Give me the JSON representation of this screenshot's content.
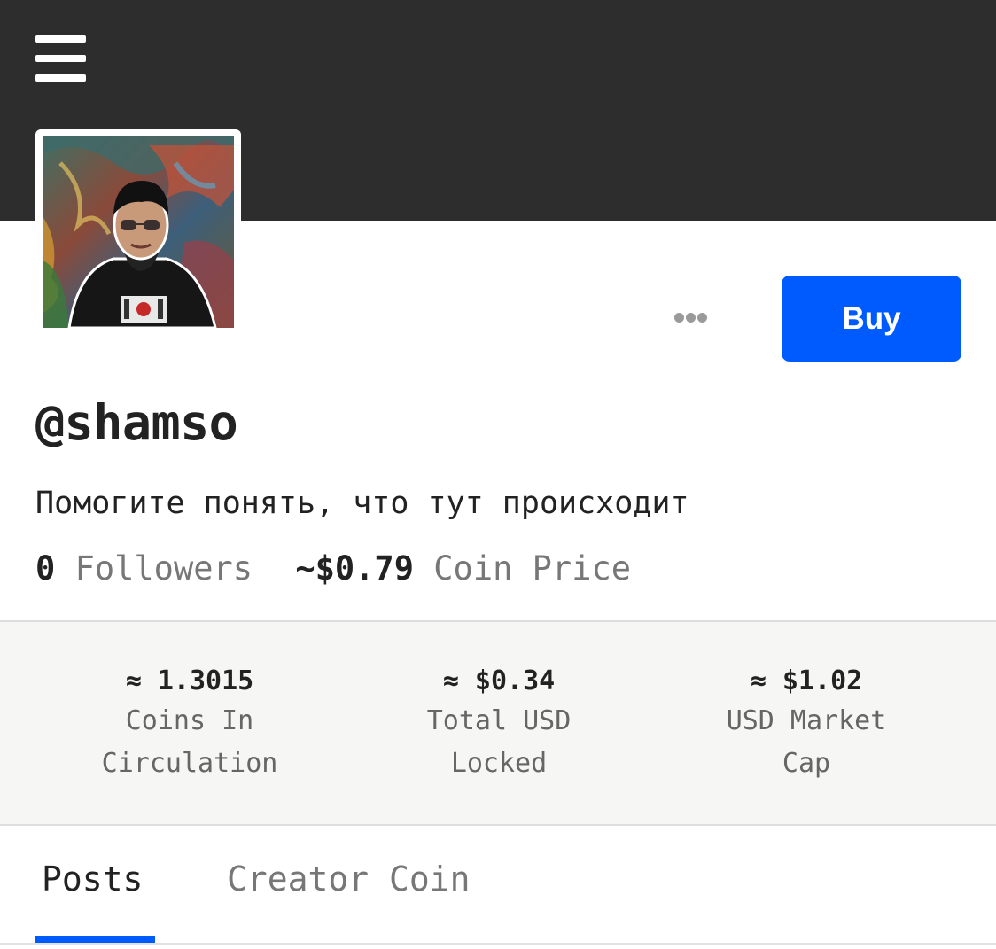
{
  "header": {
    "menu_icon": "hamburger-menu-icon",
    "banner_color": "#2d2d2d"
  },
  "profile": {
    "avatar_description": "profile-photo",
    "username": "@shamso",
    "bio": "Помогите понять, что тут происходит",
    "followers_count": "0",
    "followers_label": "Followers",
    "coin_price": "~$0.79",
    "coin_price_label": "Coin Price",
    "more_icon": "ellipsis-icon",
    "buy_label": "Buy",
    "accent_color": "#005bff"
  },
  "coin_stats": [
    {
      "value": "≈ 1.3015",
      "label_line1": "Coins In",
      "label_line2": "Circulation"
    },
    {
      "value": "≈ $0.34",
      "label_line1": "Total USD",
      "label_line2": "Locked"
    },
    {
      "value": "≈ $1.02",
      "label_line1": "USD Market",
      "label_line2": "Cap"
    }
  ],
  "tabs": [
    {
      "label": "Posts",
      "active": true
    },
    {
      "label": "Creator Coin",
      "active": false
    }
  ]
}
